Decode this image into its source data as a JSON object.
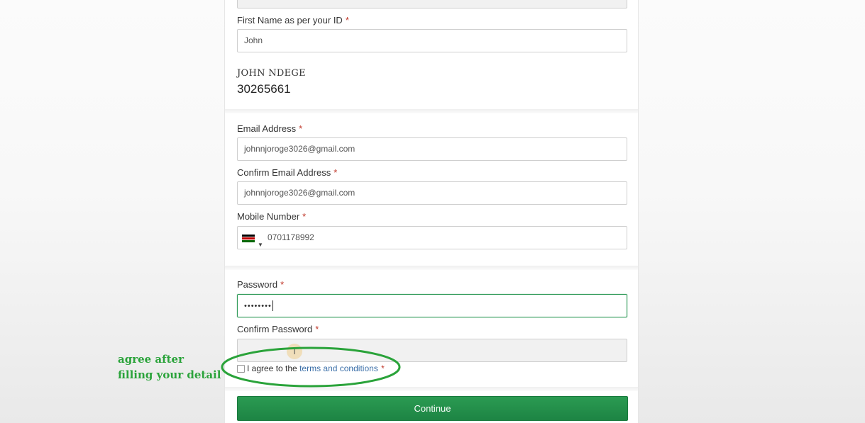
{
  "form": {
    "top_field_value": "",
    "first_name": {
      "label": "First Name as per your ID",
      "required": "*",
      "value": "John"
    },
    "full_name": "JOHN NDEGE",
    "id_number": "30265661",
    "email": {
      "label": "Email Address",
      "required": "*",
      "value": "johnnjoroge3026@gmail.com"
    },
    "confirm_email": {
      "label": "Confirm Email Address",
      "required": "*",
      "value": "johnnjoroge3026@gmail.com"
    },
    "mobile": {
      "label": "Mobile Number",
      "required": "*",
      "value": "0701178992",
      "country_flag": "kenya-flag-icon",
      "flag_colors": [
        "#000000",
        "#ffffff",
        "#bb0000",
        "#ffffff",
        "#006600"
      ]
    },
    "password": {
      "label": "Password",
      "required": "*",
      "value": "••••••••"
    },
    "confirm_password": {
      "label": "Confirm Password",
      "required": "*",
      "value": ""
    },
    "terms": {
      "prefix": "I agree to the",
      "link": "terms and conditions",
      "required": "*",
      "checked": false
    },
    "continue_label": "Continue",
    "accent_color": "#1f8a47"
  },
  "annotation": {
    "line1": "agree after",
    "line2": "filling your detail",
    "color": "#2aa33a"
  },
  "cursor": {
    "glyph": "I"
  }
}
